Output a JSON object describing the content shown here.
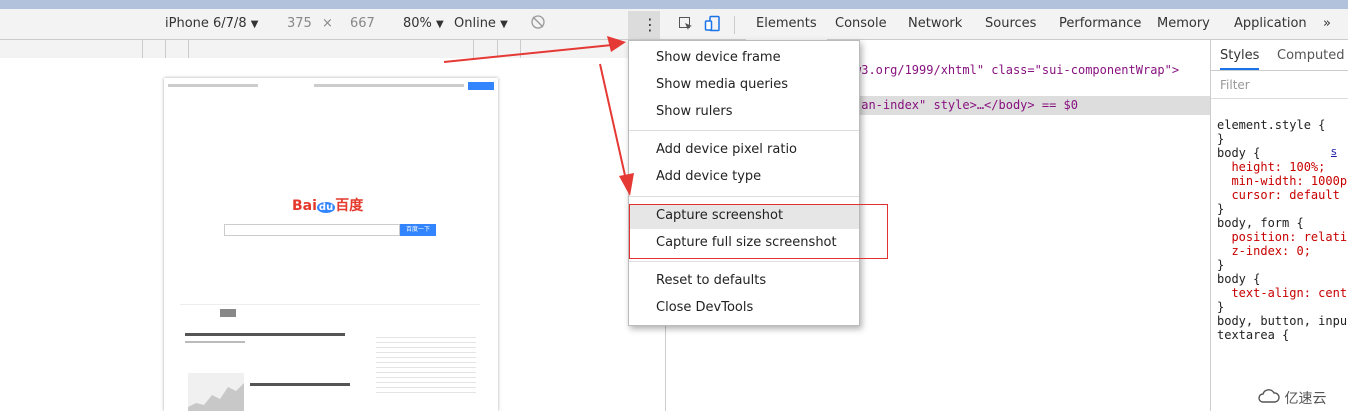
{
  "device_toolbar": {
    "device": "iPhone 6/7/8",
    "width": "375",
    "times": "×",
    "height": "667",
    "zoom": "80%",
    "network": "Online",
    "dropdown_caret": "▼"
  },
  "tabs": [
    "Elements",
    "Console",
    "Network",
    "Sources",
    "Performance",
    "Memory",
    "Application"
  ],
  "tabs_overflow": "»",
  "more_button": "⋮",
  "menu": {
    "items": [
      "Show device frame",
      "Show media queries",
      "Show rulers",
      "Add device pixel ratio",
      "Add device type",
      "Capture screenshot",
      "Capture full size screenshot",
      "Reset to defaults",
      "Close DevTools"
    ]
  },
  "elements_code": {
    "line1": "w3.org/1999/xhtml\" class=\"sui-componentWrap\">",
    "line2": "tan-index\" style>…</body> == $0"
  },
  "styles": {
    "tab_styles": "Styles",
    "tab_computed": "Computed",
    "filter_placeholder": "Filter",
    "lines": [
      "element.style {",
      "}",
      "body {",
      "  height: 100%;",
      "  min-width: 1000p",
      "  cursor: default",
      "}",
      "body, form {",
      "  position: relati",
      "  z-index: 0;",
      "}",
      "body {",
      "  text-align: cent",
      "}",
      "body, button, inpu",
      "textarea {"
    ],
    "source_link": "s"
  },
  "watermark": "亿速云",
  "colors": {
    "accent_blue": "#1a73e8",
    "arrow_red": "#e53935",
    "baidu_blue": "#3385ff"
  },
  "page_preview": {
    "logo_text_left": "Bai",
    "logo_text_mid": "du",
    "logo_text_right": "百度",
    "search_button": "百度一下"
  }
}
